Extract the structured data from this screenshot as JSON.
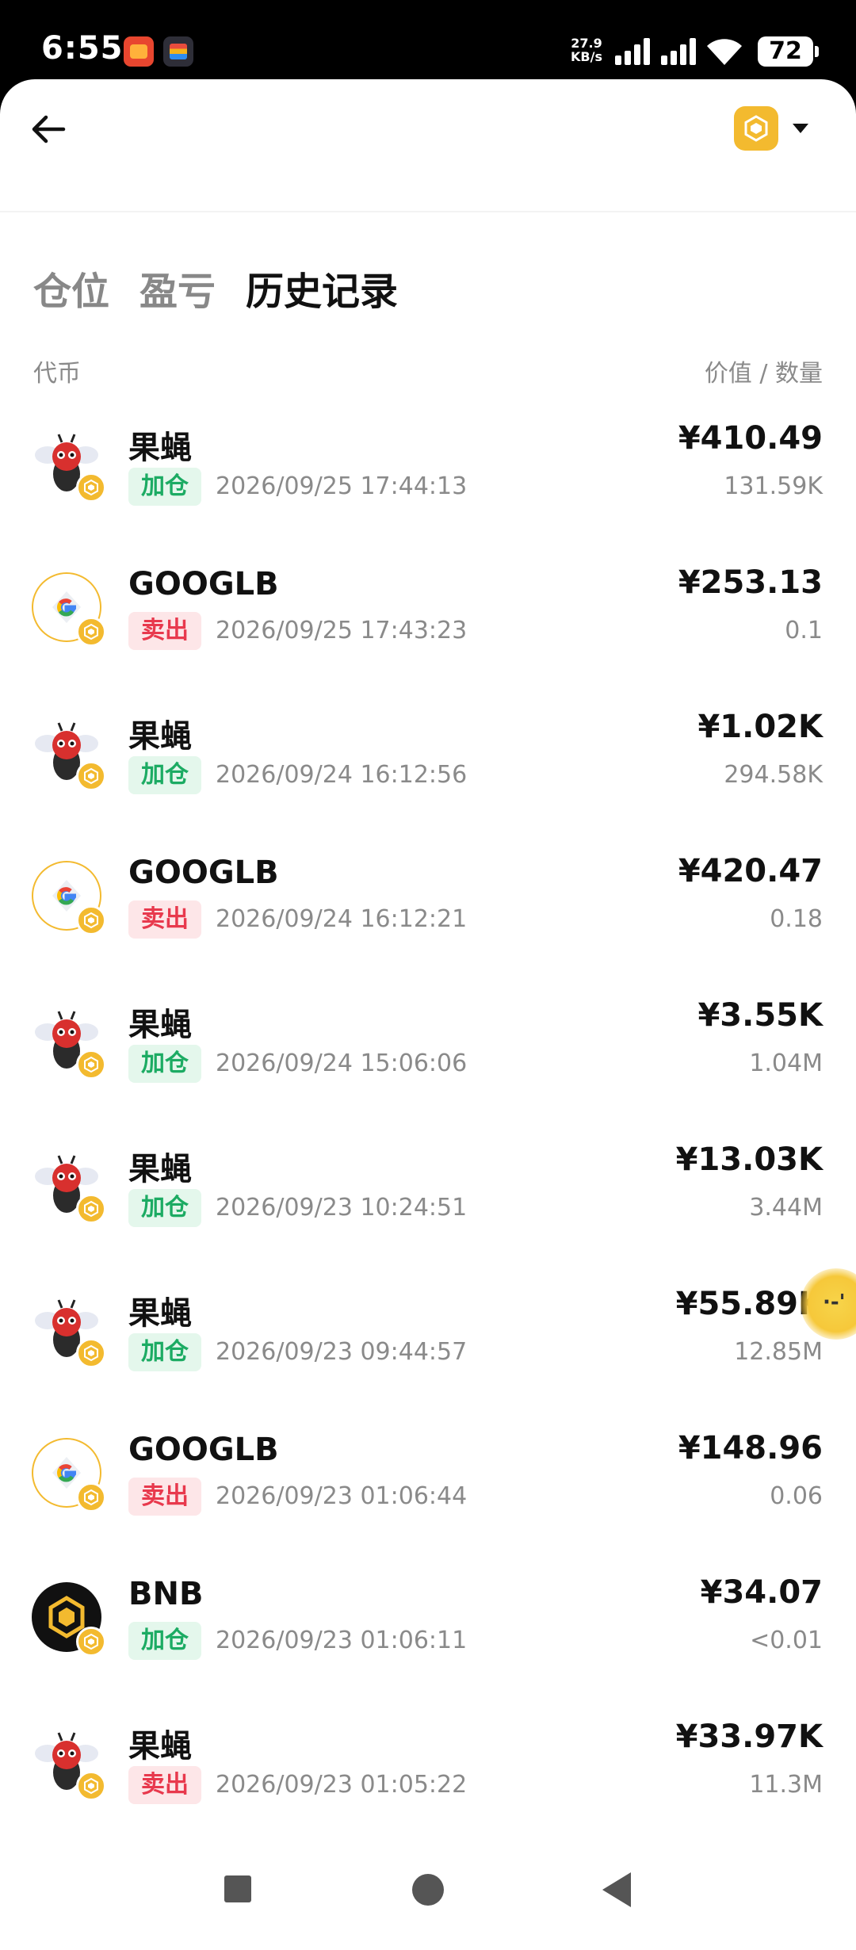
{
  "status_bar": {
    "time": "6:55",
    "net_speed_value": "27.9",
    "net_speed_unit": "KB/s",
    "battery": "72"
  },
  "header": {
    "back_icon": "arrow-left-icon",
    "network_icon": "bnb-chain-icon"
  },
  "tabs": [
    {
      "label": "仓位",
      "active": false
    },
    {
      "label": "盈亏",
      "active": false
    },
    {
      "label": "历史记录",
      "active": true
    }
  ],
  "columns": {
    "token": "代币",
    "value_qty": "价值 / 数量"
  },
  "rows": [
    {
      "name": "果蝇",
      "icon": "fly-token",
      "action": "加仓",
      "type": "buy",
      "time": "2026/09/25 17:44:13",
      "value": "¥410.49",
      "qty": "131.59K"
    },
    {
      "name": "GOOGLB",
      "icon": "google-token",
      "action": "卖出",
      "type": "sell",
      "time": "2026/09/25 17:43:23",
      "value": "¥253.13",
      "qty": "0.1"
    },
    {
      "name": "果蝇",
      "icon": "fly-token",
      "action": "加仓",
      "type": "buy",
      "time": "2026/09/24 16:12:56",
      "value": "¥1.02K",
      "qty": "294.58K"
    },
    {
      "name": "GOOGLB",
      "icon": "google-token",
      "action": "卖出",
      "type": "sell",
      "time": "2026/09/24 16:12:21",
      "value": "¥420.47",
      "qty": "0.18"
    },
    {
      "name": "果蝇",
      "icon": "fly-token",
      "action": "加仓",
      "type": "buy",
      "time": "2026/09/24 15:06:06",
      "value": "¥3.55K",
      "qty": "1.04M"
    },
    {
      "name": "果蝇",
      "icon": "fly-token",
      "action": "加仓",
      "type": "buy",
      "time": "2026/09/23 10:24:51",
      "value": "¥13.03K",
      "qty": "3.44M"
    },
    {
      "name": "果蝇",
      "icon": "fly-token",
      "action": "加仓",
      "type": "buy",
      "time": "2026/09/23 09:44:57",
      "value": "¥55.89K",
      "qty": "12.85M"
    },
    {
      "name": "GOOGLB",
      "icon": "google-token",
      "action": "卖出",
      "type": "sell",
      "time": "2026/09/23 01:06:44",
      "value": "¥148.96",
      "qty": "0.06"
    },
    {
      "name": "BNB",
      "icon": "bnb-token",
      "action": "加仓",
      "type": "buy",
      "time": "2026/09/23 01:06:11",
      "value": "¥34.07",
      "qty": "<0.01"
    },
    {
      "name": "果蝇",
      "icon": "fly-token",
      "action": "卖出",
      "type": "sell",
      "time": "2026/09/23 01:05:22",
      "value": "¥33.97K",
      "qty": "11.3M"
    }
  ],
  "colors": {
    "accent": "#f3ba2f",
    "buy": "#1cab63",
    "sell": "#e8394d"
  }
}
